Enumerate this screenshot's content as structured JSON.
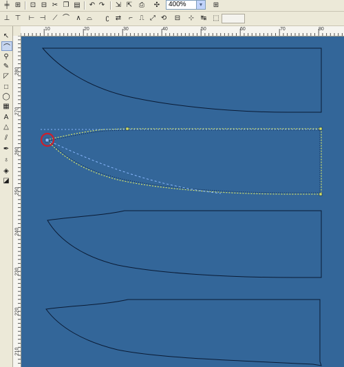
{
  "toolbar": {
    "zoom_value": "400%",
    "icons_row1": [
      "align-icon",
      "distribute-icon",
      "combine-icon",
      "break-apart-icon",
      "cut-icon",
      "copy-icon",
      "paste-icon",
      "undo-icon",
      "redo-icon",
      "import-icon",
      "export-icon",
      "print-icon",
      "zoom-dropdown-icon"
    ],
    "icons_row2": [
      "node-add-icon",
      "node-delete-icon",
      "join-nodes-icon",
      "break-curve-icon",
      "to-line-icon",
      "to-curve-icon",
      "cusp-icon",
      "smooth-icon",
      "symmetric-icon",
      "reverse-icon",
      "extend-icon",
      "extract-icon",
      "stretch-icon",
      "rotate-icon",
      "align-nodes-icon",
      "elastic-icon"
    ]
  },
  "toolbox": {
    "tools": [
      "pick-tool",
      "shape-tool",
      "zoom-tool",
      "freehand-tool",
      "smart-fill-tool",
      "rectangle-tool",
      "ellipse-tool",
      "polygon-tool",
      "text-tool",
      "interactive-tool",
      "eyedropper-tool",
      "outline-tool",
      "fill-tool",
      "interactive-fill-tool"
    ]
  },
  "ruler_h": {
    "labels": [
      "10",
      "20",
      "30",
      "40",
      "50",
      "60",
      "70",
      "80"
    ]
  },
  "ruler_v": {
    "labels": [
      "280",
      "270",
      "260",
      "250",
      "240",
      "230",
      "220",
      "210"
    ]
  },
  "colors": {
    "canvas": "#336699",
    "outline": "#0a1a33",
    "selection_dotted": "#d6e36a",
    "selection_blue": "#8ab8ff",
    "highlight_circle": "#cc1f2c"
  }
}
